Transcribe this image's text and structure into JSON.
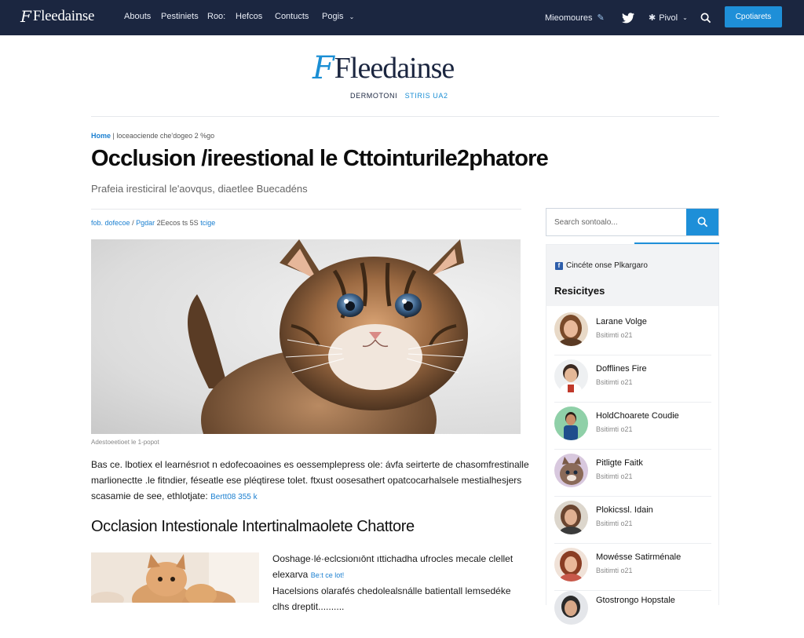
{
  "topbar": {
    "logo_mark": "F",
    "logo_word": "Fleedainse",
    "nav": [
      "Abouts",
      "Pestiniets",
      "Roo:",
      "Hefcos",
      "Contucts",
      "Pogis"
    ],
    "right_link": "Mieomoures",
    "social_label": "Pivol",
    "cta": "Cpotiarets",
    "colors": {
      "bar": "#1b2640",
      "accent": "#1e8fd8"
    }
  },
  "masthead": {
    "logo_mark": "F",
    "logo_word": "Fleedainse",
    "tag_main": "DERMOTONI",
    "tag_accent": "STIRIS UA2"
  },
  "breadcrumb": {
    "home": "Home",
    "rest": "| loceaociende che'dogeo 2 %go"
  },
  "article": {
    "title": "Occlusion /ireestional le Cttointurile2phatore",
    "subtitle": "Prafeia iresticiral le'aovqus, diaetlee Buecadéns",
    "meta_prefix": "fob. dofecoe",
    "meta_sep": "/",
    "meta_accent": "Pgdar",
    "meta_rest": "2Eecos ts 5S",
    "meta_tag": "tcige",
    "image_caption": "Adestoeetioet le 1-popot",
    "para1_l1": "Bas ce. lbotiex el learnésrıot n edofecoaoines es oessemplepress ole: ávfa seirterte de chasomfrestinalle",
    "para1_l2": "marlionectte .le fitndier, féseatle ese pléqtirese tolet. ftxust oosesathert opatcocarhalsele mestialhesjers",
    "para1_l3": "scasamie de see, ethlotjate:",
    "para1_link": "Bertt08 355 k",
    "h2": "Occlasion Intestionale Intertinalmaolete Chattore",
    "para2_l1": "Ooshage·lé·eclcsionıōnt ıttichadha ufrocles mecale clellet",
    "para2_l2": "elexarva",
    "para2_link": "Be:t ce lot!",
    "para2_l3": "Hacelsions olarafés chedolealsnálle batientall lemsedéke",
    "para2_l4": "clhs dreptit.........."
  },
  "sidebar": {
    "search_placeholder": "Search sontoalo...",
    "fb_text": "Cincéte onse Plkargaro",
    "title": "Resicityes",
    "people": [
      {
        "name": "Larane Volge",
        "role": "Bsitimti o21"
      },
      {
        "name": "Dofflines Fire",
        "role": "Bsitimti o21"
      },
      {
        "name": "HoldChoarete Coudie",
        "role": "Bsitimti o21"
      },
      {
        "name": "Pitligte Faitk",
        "role": "Bsitimti o21"
      },
      {
        "name": "Plokicssl. Idain",
        "role": "Bsitimti o21"
      },
      {
        "name": "Mowésse Satirménale",
        "role": "Bsitimti o21"
      },
      {
        "name": "Gtostrongo Hopstale",
        "role": ""
      }
    ]
  }
}
